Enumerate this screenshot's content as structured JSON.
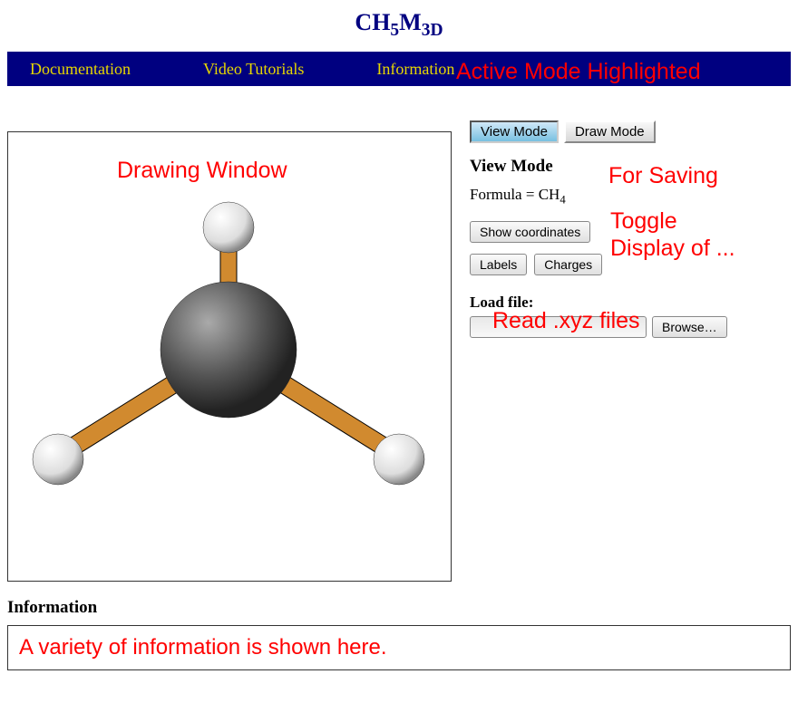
{
  "title_parts": [
    "CH",
    "5",
    "M",
    "3D"
  ],
  "nav": {
    "documentation": "Documentation",
    "tutorials": "Video Tutorials",
    "information": "Information"
  },
  "annotations": {
    "active_mode": "Active Mode Highlighted",
    "drawing_window": "Drawing Window",
    "for_saving": "For Saving",
    "toggle": "Toggle",
    "toggle2": "Display of ...",
    "read_xyz": "Read .xyz files"
  },
  "modes": {
    "view": "View Mode",
    "draw": "Draw Mode"
  },
  "panel": {
    "heading": "View Mode",
    "formula_prefix": "Formula = CH",
    "formula_sub": "4",
    "show_coords": "Show coordinates",
    "labels": "Labels",
    "charges": "Charges",
    "load_file": "Load file:",
    "browse": "Browse…"
  },
  "info": {
    "heading": "Information",
    "body": "A variety of information is shown here."
  }
}
